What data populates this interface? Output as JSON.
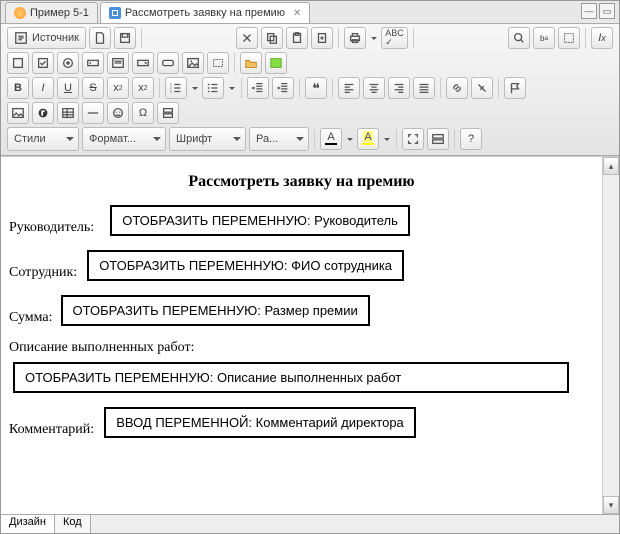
{
  "tabs": [
    {
      "label": "Пример 5-1"
    },
    {
      "label": "Рассмотреть заявку на премию"
    }
  ],
  "toolbar": {
    "source": "Источник",
    "styles": "Стили",
    "format": "Формат...",
    "font": "Шрифт",
    "size": "Ра...",
    "a_label": "А",
    "a2_label": "A"
  },
  "doc": {
    "title": "Рассмотреть заявку на премию",
    "f1": {
      "label": "Руководитель:",
      "box": "ОТОБРАЗИТЬ ПЕРЕМЕННУЮ: Руководитель"
    },
    "f2": {
      "label": "Сотрудник:",
      "box": "ОТОБРАЗИТЬ ПЕРЕМЕННУЮ: ФИО сотрудника"
    },
    "f3": {
      "label": "Сумма:",
      "box": "ОТОБРАЗИТЬ ПЕРЕМЕННУЮ: Размер премии"
    },
    "f4": {
      "label": "Описание выполненных работ:",
      "box": "ОТОБРАЗИТЬ ПЕРЕМЕННУЮ: Описание выполненных работ"
    },
    "f5": {
      "label": "Комментарий:",
      "box": "ВВОД ПЕРЕМЕННОЙ: Комментарий директора"
    }
  },
  "bottom": {
    "design": "Дизайн",
    "code": "Код"
  }
}
